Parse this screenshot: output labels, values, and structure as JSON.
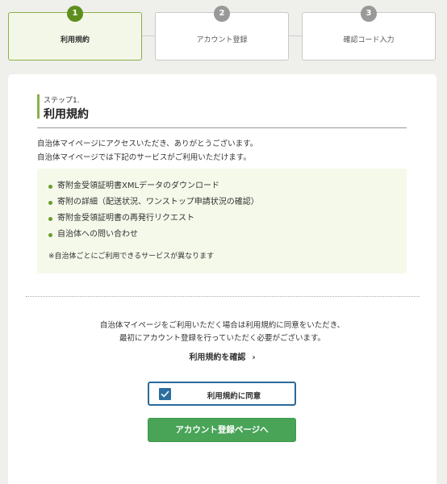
{
  "stepper": {
    "steps": [
      {
        "number": "1",
        "label": "利用規約",
        "active": true
      },
      {
        "number": "2",
        "label": "アカウント登録",
        "active": false
      },
      {
        "number": "3",
        "label": "確認コード入力",
        "active": false
      }
    ]
  },
  "section": {
    "step_label": "ステップ1.",
    "title": "利用規約"
  },
  "intro": {
    "line1": "自治体マイページにアクセスいただき、ありがとうございます。",
    "line2": "自治体マイページでは下記のサービスがご利用いただけます。"
  },
  "services": {
    "items": [
      "寄附金受領証明書XMLデータのダウンロード",
      "寄附の詳細（配送状況、ワンストップ申請状況の確認）",
      "寄附金受領証明書の再発行リクエスト",
      "自治体への問い合わせ"
    ],
    "note": "※自治体ごとにご利用できるサービスが異なります"
  },
  "terms": {
    "line1": "自治体マイページをご利用いただく場合は利用規約に同意をいただき、",
    "line2": "最初にアカウント登録を行っていただく必要がございます。",
    "link_label": "利用規約を確認",
    "link_chevron": "›"
  },
  "agree": {
    "label": "利用規約に同意",
    "checked": true
  },
  "register_button": {
    "label": "アカウント登録ページへ"
  },
  "colors": {
    "accent_green": "#5e8f1e",
    "button_green": "#49a458",
    "checkbox_blue": "#2c6e9f"
  }
}
